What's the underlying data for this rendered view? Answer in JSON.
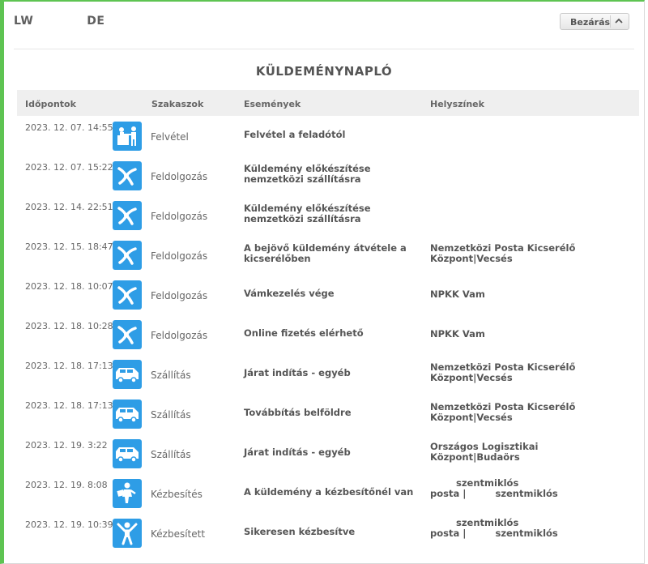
{
  "header": {
    "tracking_prefix": "LW",
    "tracking_suffix": "DE",
    "close_label": "Bezárás"
  },
  "title": "KÜLDEMÉNYNAPLÓ",
  "columns": {
    "time": "Időpontok",
    "phase": "Szakaszok",
    "event": "Események",
    "location": "Helyszínek"
  },
  "rows": [
    {
      "time": "2023. 12. 07. 14:55",
      "icon": "reception-icon",
      "phase": "Felvétel",
      "event": "Felvétel a feladótól",
      "location": ""
    },
    {
      "time": "2023. 12. 07. 15:22",
      "icon": "processing-icon",
      "phase": "Feldolgozás",
      "event": "Küldemény előkészítése nemzetközi szállításra",
      "location": ""
    },
    {
      "time": "2023. 12. 14. 22:51",
      "icon": "processing-icon",
      "phase": "Feldolgozás",
      "event": "Küldemény előkészítése nemzetközi szállításra",
      "location": ""
    },
    {
      "time": "2023. 12. 15. 18:47",
      "icon": "processing-icon",
      "phase": "Feldolgozás",
      "event": "A bejövő küldemény átvétele a kicserélőben",
      "location": "Nemzetközi Posta Kicserélő Központ|Vecsés"
    },
    {
      "time": "2023. 12. 18. 10:07",
      "icon": "processing-icon",
      "phase": "Feldolgozás",
      "event": "Vámkezelés vége",
      "location": "NPKK Vam"
    },
    {
      "time": "2023. 12. 18. 10:28",
      "icon": "processing-icon",
      "phase": "Feldolgozás",
      "event": "Online fizetés elérhető",
      "location": "NPKK Vam"
    },
    {
      "time": "2023. 12. 18. 17:13",
      "icon": "van-icon",
      "phase": "Szállítás",
      "event": "Járat indítás - egyéb",
      "location": "Nemzetközi Posta Kicserélő Központ|Vecsés"
    },
    {
      "time": "2023. 12. 18. 17:13",
      "icon": "van-icon",
      "phase": "Szállítás",
      "event": "Továbbítás belföldre",
      "location": "Nemzetközi Posta Kicserélő Központ|Vecsés"
    },
    {
      "time": "2023. 12. 19. 3:22",
      "icon": "van-icon",
      "phase": "Szállítás",
      "event": "Járat indítás - egyéb",
      "location": "Országos Logisztikai Központ|Budaörs"
    },
    {
      "time": "2023. 12. 19. 8:08",
      "icon": "courier-icon",
      "phase": "Kézbesítés",
      "event": "A küldemény a kézbesítőnél van",
      "location_line1": "szentmiklós",
      "location_line2a": "posta",
      "location_line2b": "szentmiklós"
    },
    {
      "time": "2023. 12. 19. 10:39",
      "icon": "delivered-icon",
      "phase": "Kézbesített",
      "event": "Sikeresen kézbesítve",
      "location_line1": "szentmiklós",
      "location_line2a": "posta",
      "location_line2b": "szentmiklós"
    }
  ],
  "colors": {
    "accent_green": "#5ec452",
    "icon_blue": "#2e9de6"
  }
}
